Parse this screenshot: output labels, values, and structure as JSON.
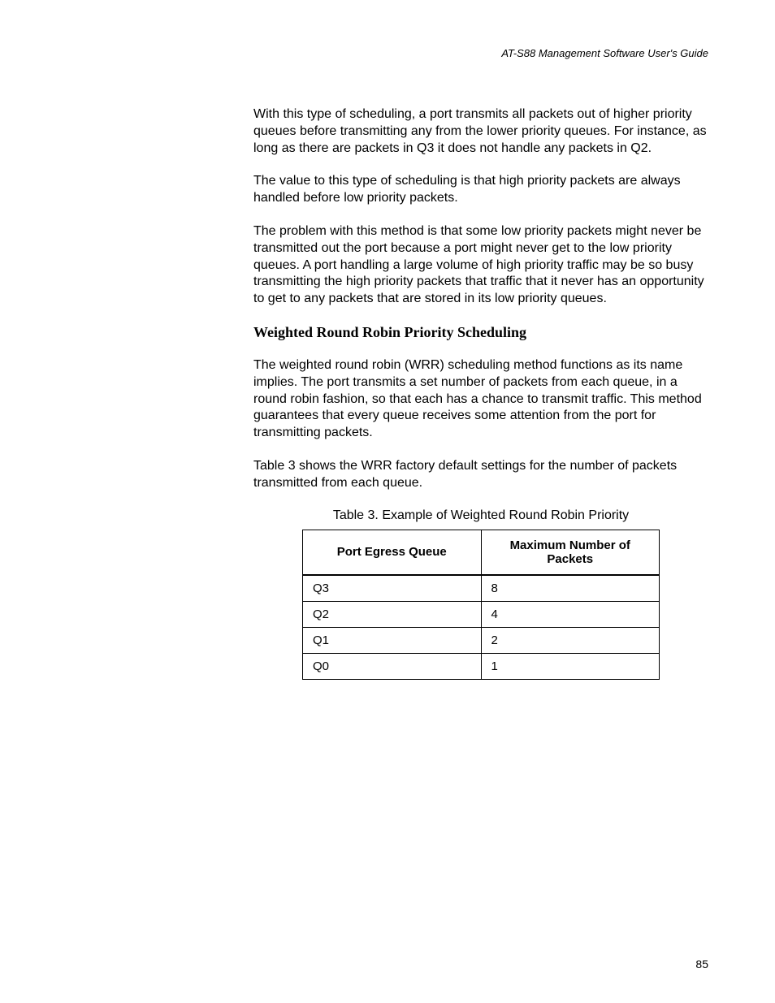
{
  "header": "AT-S88 Management Software User's Guide",
  "paragraphs": {
    "p1": "With this type of scheduling, a port transmits all packets out of higher priority queues before transmitting any from the lower priority queues. For instance, as long as there are packets in Q3 it does not handle any packets in Q2.",
    "p2": "The value to this type of scheduling is that high priority packets are always handled before low priority packets.",
    "p3": "The problem with this method is that some low priority packets might never be transmitted out the port because a port might never get to the low priority queues. A port handling a large volume of high priority traffic may be so busy transmitting the high priority packets that traffic that it never has an opportunity to get to any packets that are stored in its low priority queues.",
    "p4": "The weighted round robin (WRR) scheduling method functions as its name implies. The port transmits a set number of packets from each queue, in a round robin fashion, so that each has a chance to transmit traffic. This method guarantees that every queue receives some attention from the port for transmitting packets.",
    "p5": "Table 3 shows the WRR factory default settings for the number of packets transmitted from each queue."
  },
  "subheading": "Weighted Round Robin Priority Scheduling",
  "table": {
    "caption": "Table 3. Example of Weighted Round Robin Priority",
    "headers": {
      "col1": "Port Egress Queue",
      "col2": "Maximum Number of Packets"
    },
    "rows": [
      {
        "queue": "Q3",
        "packets": "8"
      },
      {
        "queue": "Q2",
        "packets": "4"
      },
      {
        "queue": "Q1",
        "packets": "2"
      },
      {
        "queue": "Q0",
        "packets": "1"
      }
    ]
  },
  "chart_data": {
    "type": "table",
    "title": "Example of Weighted Round Robin Priority",
    "columns": [
      "Port Egress Queue",
      "Maximum Number of Packets"
    ],
    "rows": [
      [
        "Q3",
        8
      ],
      [
        "Q2",
        4
      ],
      [
        "Q1",
        2
      ],
      [
        "Q0",
        1
      ]
    ]
  },
  "page_number": "85"
}
